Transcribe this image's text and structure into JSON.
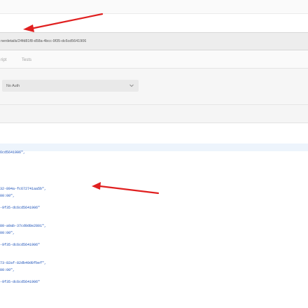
{
  "request": {
    "url": "nerdetails/24fd81f8-d58a-4bcc-9f35-dc6cd5641906"
  },
  "tabs": [
    {
      "label": "ript"
    },
    {
      "label": "Tests"
    }
  ],
  "auth": {
    "type_value": "No Auth"
  },
  "response": {
    "lines": [
      "6cd5641906\",",
      "32-894a-fc672741aa5b\",",
      "00:00\",",
      "-9f35-dc6cd5641906\"",
      "80-a9ab-37cd0d8e2801\",",
      "00:00\",",
      "-9f35-dc6cd5641906\"",
      "73-82af-82db49d0fbef\",",
      "00:00\",",
      "-9f35-dc6cd5641906\""
    ]
  },
  "annotations": {
    "arrow_color": "#e02020"
  },
  "colors": {
    "url_bar": "#ededed",
    "code_text": "#1a50b8",
    "highlight_line": "#edf4fc"
  }
}
